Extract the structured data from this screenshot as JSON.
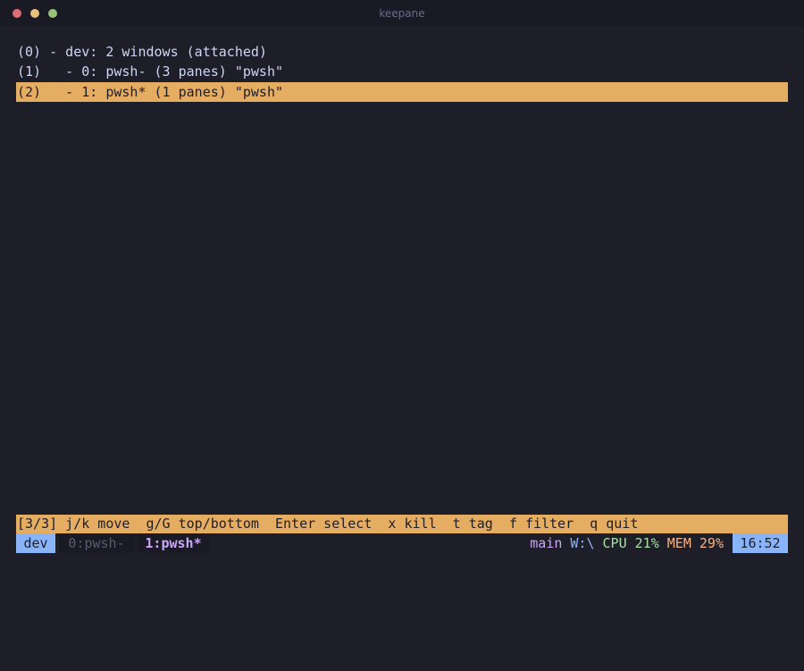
{
  "window": {
    "title": "keepane"
  },
  "tree": {
    "rows": [
      {
        "text": "(0) - dev: 2 windows (attached)"
      },
      {
        "text": "(1)   - 0: pwsh- (3 panes) \"pwsh\""
      },
      {
        "text": "(2)   - 1: pwsh* (1 panes) \"pwsh\""
      }
    ],
    "selected_index": 2
  },
  "helpbar": {
    "text": "[3/3] j/k move  g/G top/bottom  Enter select  x kill  t tag  f filter  q quit"
  },
  "statusbar": {
    "session": "dev",
    "windows": [
      {
        "label": "0:pwsh-",
        "active": false
      },
      {
        "label": "1:pwsh*",
        "active": true
      }
    ],
    "branch": "main",
    "path": "W:\\",
    "cpu": "CPU 21%",
    "mem": "MEM 29%",
    "clock": "16:52"
  },
  "colors": {
    "background": "#1e1e28",
    "highlight": "#e5ad62",
    "accent_blue": "#89b4fa",
    "accent_purple": "#cba6f7"
  }
}
